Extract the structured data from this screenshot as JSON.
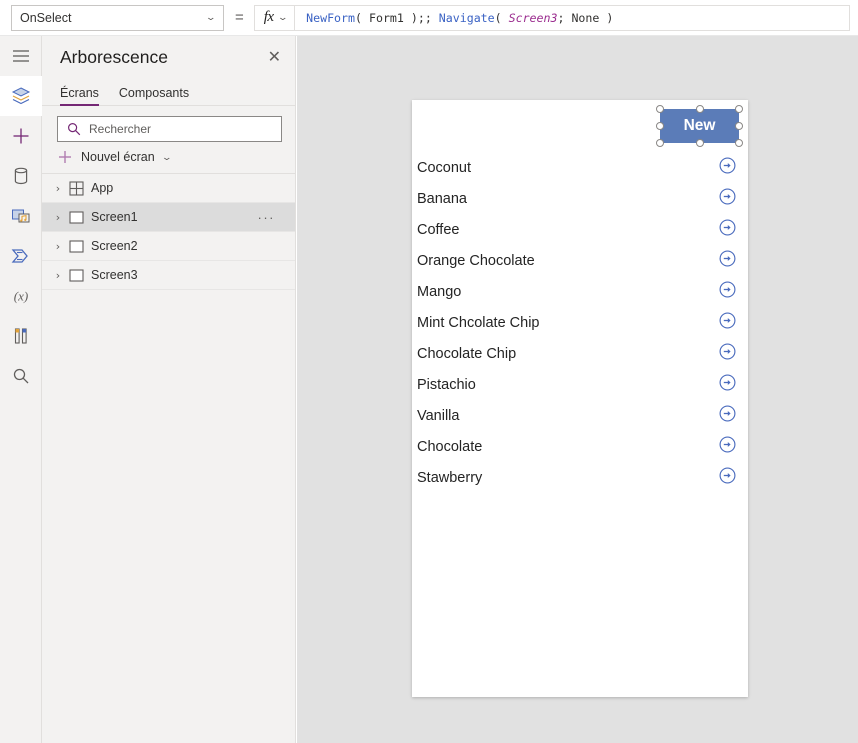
{
  "formula_bar": {
    "property": "OnSelect",
    "property_caret": "⌄",
    "equals": "=",
    "fx_label": "fx",
    "fx_caret": "⌄",
    "formula_text": "NewForm( Form1 );; Navigate( Screen3; None )",
    "tokens": [
      {
        "text": "NewForm",
        "type": "fn"
      },
      {
        "text": "( ",
        "type": "punct"
      },
      {
        "text": "Form1",
        "type": "ident"
      },
      {
        "text": " );; ",
        "type": "punct"
      },
      {
        "text": "Navigate",
        "type": "fn"
      },
      {
        "text": "( ",
        "type": "punct"
      },
      {
        "text": "Screen3",
        "type": "screen"
      },
      {
        "text": "; ",
        "type": "punct"
      },
      {
        "text": "None",
        "type": "ident"
      },
      {
        "text": " )",
        "type": "punct"
      }
    ]
  },
  "left_rail": {
    "items": [
      {
        "icon": "hamburger-menu-icon",
        "name": "menu",
        "active": false
      },
      {
        "icon": "layers-tree-icon",
        "name": "tree-view",
        "active": true
      },
      {
        "icon": "plus-insert-icon",
        "name": "insert",
        "active": false
      },
      {
        "icon": "database-data-icon",
        "name": "data",
        "active": false
      },
      {
        "icon": "media-icon",
        "name": "media",
        "active": false
      },
      {
        "icon": "power-automate-icon",
        "name": "power-automate",
        "active": false
      },
      {
        "icon": "variables-x-icon",
        "name": "variables",
        "active": false
      },
      {
        "icon": "tools-icon",
        "name": "advanced-tools",
        "active": false
      },
      {
        "icon": "search-icon",
        "name": "search",
        "active": false
      }
    ]
  },
  "tree_panel": {
    "title": "Arborescence",
    "close_label": "✕",
    "tabs": [
      {
        "label": "Écrans",
        "active": true
      },
      {
        "label": "Composants",
        "active": false
      }
    ],
    "search": {
      "placeholder": "Rechercher",
      "value": ""
    },
    "new_screen": {
      "label": "Nouvel écran",
      "caret": "⌄",
      "plus": "+"
    },
    "items": [
      {
        "label": "App",
        "icon": "app-grid-icon",
        "chevron": "›",
        "selected": false,
        "has_menu": false
      },
      {
        "label": "Screen1",
        "icon": "screen-rect-icon",
        "chevron": "›",
        "selected": true,
        "has_menu": true,
        "menu_label": "···"
      },
      {
        "label": "Screen2",
        "icon": "screen-rect-icon",
        "chevron": "›",
        "selected": false,
        "has_menu": false
      },
      {
        "label": "Screen3",
        "icon": "screen-rect-icon",
        "chevron": "›",
        "selected": false,
        "has_menu": false
      }
    ]
  },
  "canvas": {
    "new_button": {
      "label": "New",
      "color": "#5b7cb8",
      "text_color": "#ffffff",
      "selected": true
    },
    "gallery": {
      "arrow_icon": "circle-arrow-right-icon",
      "arrow_color": "#4a6bbd",
      "rows": [
        {
          "label": "Coconut"
        },
        {
          "label": "Banana"
        },
        {
          "label": "Coffee"
        },
        {
          "label": "Orange Chocolate"
        },
        {
          "label": "Mango"
        },
        {
          "label": "Mint Chcolate Chip"
        },
        {
          "label": "Chocolate Chip"
        },
        {
          "label": "Pistachio"
        },
        {
          "label": "Vanilla"
        },
        {
          "label": "Chocolate"
        },
        {
          "label": "Stawberry"
        }
      ]
    }
  },
  "colors": {
    "accent_purple": "#742774",
    "button_blue": "#5b7cb8",
    "formula_fn_blue": "#3a62c4",
    "formula_screen_magenta": "#9b2d8f",
    "panel_bg": "#f3f2f1",
    "canvas_bg": "#e1e1e1"
  }
}
